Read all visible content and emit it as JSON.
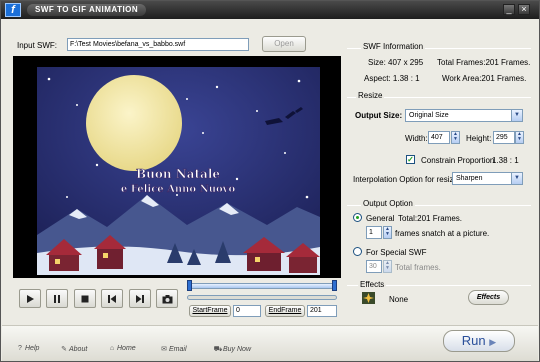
{
  "window": {
    "title": "SWF TO GIF ANIMATION",
    "minimize_label": "_",
    "close_label": "×"
  },
  "input": {
    "label": "Input SWF:",
    "value": "F:\\Test Movies\\befana_vs_babbo.swf",
    "open_label": "Open"
  },
  "preview": {
    "greeting_line1": "Buon Natale",
    "greeting_line2": "e Felice Anno Nuovo",
    "colors": {
      "sky": "#242a6a",
      "moon": "#f3e8a8",
      "snow": "#dfe7f5",
      "mountain": "#4a5a92",
      "roof": "#a52a3a"
    }
  },
  "swf_info": {
    "title": "SWF Information",
    "size": "Size:  407 x 295",
    "total_frames": "Total Frames:201 Frames.",
    "aspect": "Aspect:  1.38 : 1",
    "work_area": "Work Area:201 Frames."
  },
  "resize": {
    "title": "Resize",
    "output_size_label": "Output Size:",
    "output_size_value": "Original Size",
    "width_label": "Width:",
    "width_value": "407",
    "height_label": "Height:",
    "height_value": "295",
    "constrain_label": "Constrain Proportion",
    "constrain_value": "1.38 : 1",
    "interp_label": "Interpolation Option for resize:",
    "interp_value": "Sharpen"
  },
  "output_option": {
    "title": "Output Option",
    "general_label": "General",
    "general_total": "Total:201 Frames.",
    "frames_value": "1",
    "frames_label": "frames snatch at a picture.",
    "special_label": "For Special SWF",
    "total_value": "30",
    "total_label": "Total frames."
  },
  "effects": {
    "title": "Effects",
    "value": "None",
    "button_label": "Effects"
  },
  "frames": {
    "start_label": "StartFrame",
    "start_value": "0",
    "end_label": "EndFrame",
    "end_value": "201"
  },
  "footer": {
    "help": "Help",
    "about": "About",
    "home": "Home",
    "email": "Email",
    "buy": "Buy Now",
    "run": "Run"
  }
}
